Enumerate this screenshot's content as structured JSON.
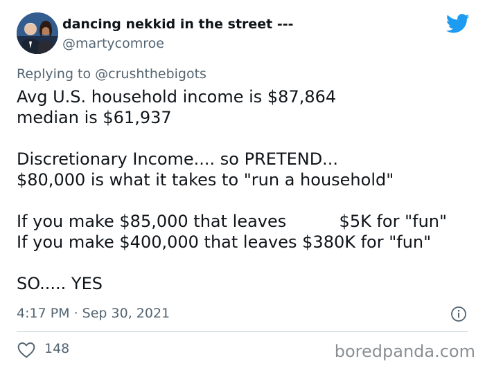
{
  "author": {
    "display_name": "dancing nekkid in the street ---",
    "handle": "@martycomroe",
    "avatar_icon": "profile-photo"
  },
  "reply_context": {
    "prefix": "Replying to ",
    "mention": "@crushthebigots"
  },
  "tweet": {
    "lines": [
      "Avg U.S. household income is $87,864",
      "median is $61,937",
      "",
      "Discretionary Income.... so PRETEND...",
      "$80,000 is what it takes to \"run a household\"",
      "",
      "If you make $85,000 that leaves          $5K for \"fun\"",
      "If you make $400,000 that leaves $380K for \"fun\"",
      "",
      "SO..... YES"
    ],
    "timestamp": "4:17 PM · Sep 30, 2021",
    "likes": "148"
  },
  "watermark": "boredpanda.com",
  "colors": {
    "twitter_blue": "#1d9bf0",
    "secondary_text": "#536471",
    "primary_text": "#0f1419"
  }
}
